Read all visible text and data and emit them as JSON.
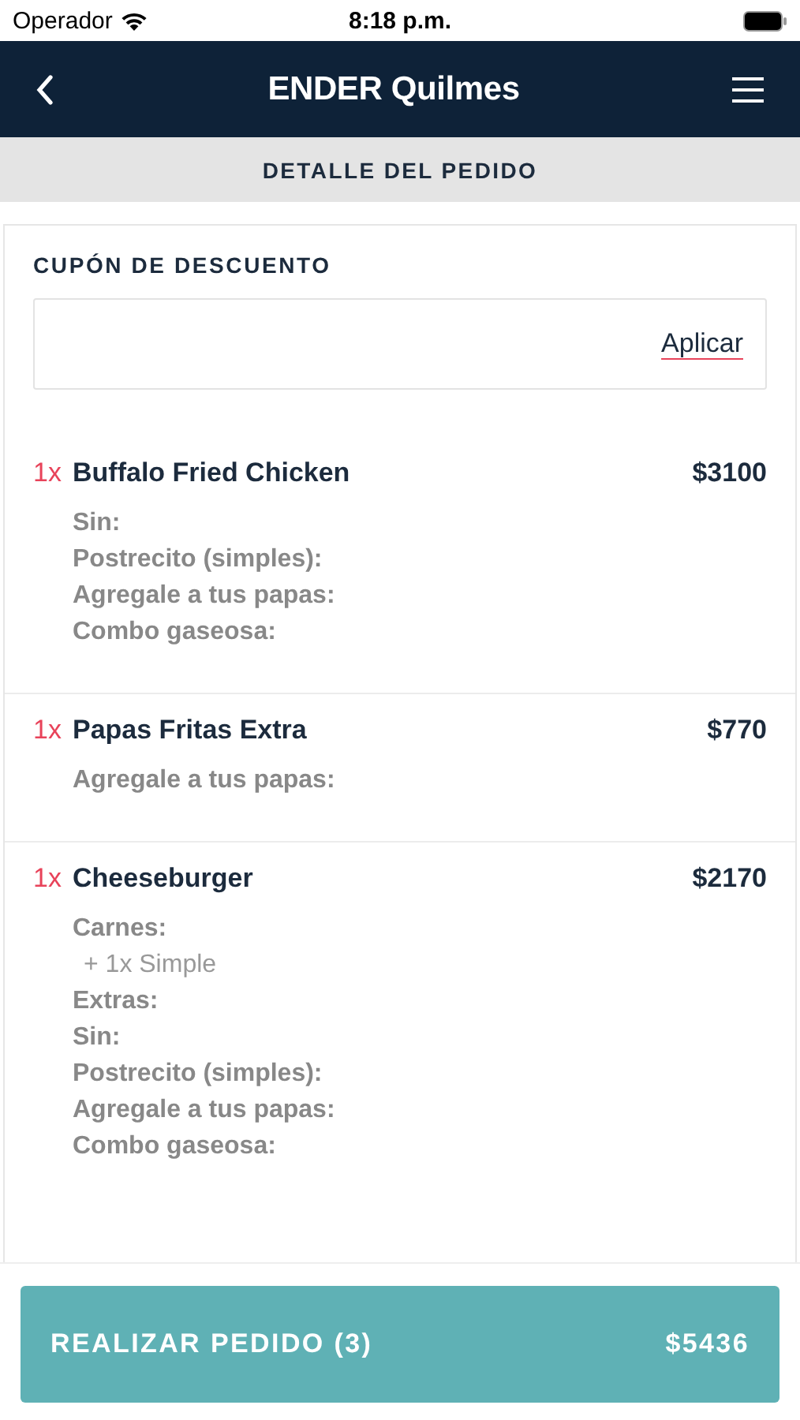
{
  "status_bar": {
    "carrier": "Operador",
    "time": "8:18 p.m."
  },
  "nav": {
    "title": "ENDER Quilmes"
  },
  "section_title": "DETALLE DEL PEDIDO",
  "coupon": {
    "label": "CUPÓN DE DESCUENTO",
    "apply": "Aplicar"
  },
  "items": [
    {
      "qty": "1x",
      "name": "Buffalo Fried Chicken",
      "price": "$3100",
      "options": [
        {
          "kind": "group",
          "text": "Sin:"
        },
        {
          "kind": "group",
          "text": "Postrecito (simples):"
        },
        {
          "kind": "group",
          "text": "Agregale a tus papas:"
        },
        {
          "kind": "group",
          "text": "Combo gaseosa:"
        }
      ]
    },
    {
      "qty": "1x",
      "name": "Papas Fritas Extra",
      "price": "$770",
      "options": [
        {
          "kind": "group",
          "text": "Agregale a tus papas:"
        }
      ]
    },
    {
      "qty": "1x",
      "name": "Cheeseburger",
      "price": "$2170",
      "options": [
        {
          "kind": "group",
          "text": "Carnes:"
        },
        {
          "kind": "choice",
          "text": "+ 1x Simple"
        },
        {
          "kind": "group",
          "text": "Extras:"
        },
        {
          "kind": "group",
          "text": "Sin:"
        },
        {
          "kind": "group",
          "text": "Postrecito (simples):"
        },
        {
          "kind": "group",
          "text": "Agregale a tus papas:"
        },
        {
          "kind": "group",
          "text": "Combo gaseosa:"
        }
      ]
    }
  ],
  "order_button": {
    "label": "REALIZAR PEDIDO (3)",
    "total": "$5436"
  }
}
